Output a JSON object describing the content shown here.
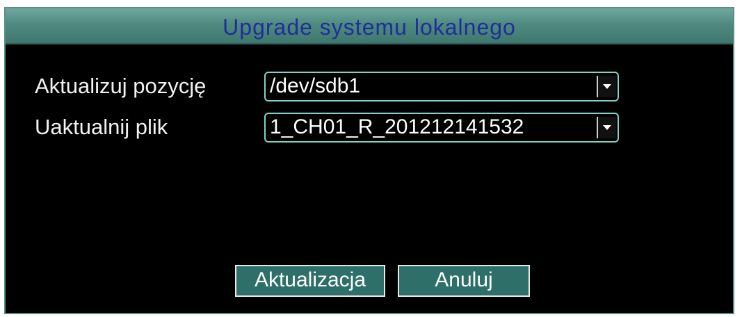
{
  "dialog": {
    "title": "Upgrade systemu lokalnego"
  },
  "form": {
    "update_position": {
      "label": "Aktualizuj pozycję",
      "value": "/dev/sdb1"
    },
    "update_file": {
      "label": "Uaktualnij plik",
      "value": "1_CH01_R_201212141532"
    }
  },
  "buttons": {
    "upgrade_label": "Aktualizacja",
    "cancel_label": "Anuluj"
  },
  "icons": {
    "dropdown": "chevron-down-icon"
  },
  "colors": {
    "titlebar": "#4f8a80",
    "title_text": "#1f2f9a",
    "background": "#000000",
    "accent": "#7fd3c8",
    "button": "#2e6f69"
  }
}
